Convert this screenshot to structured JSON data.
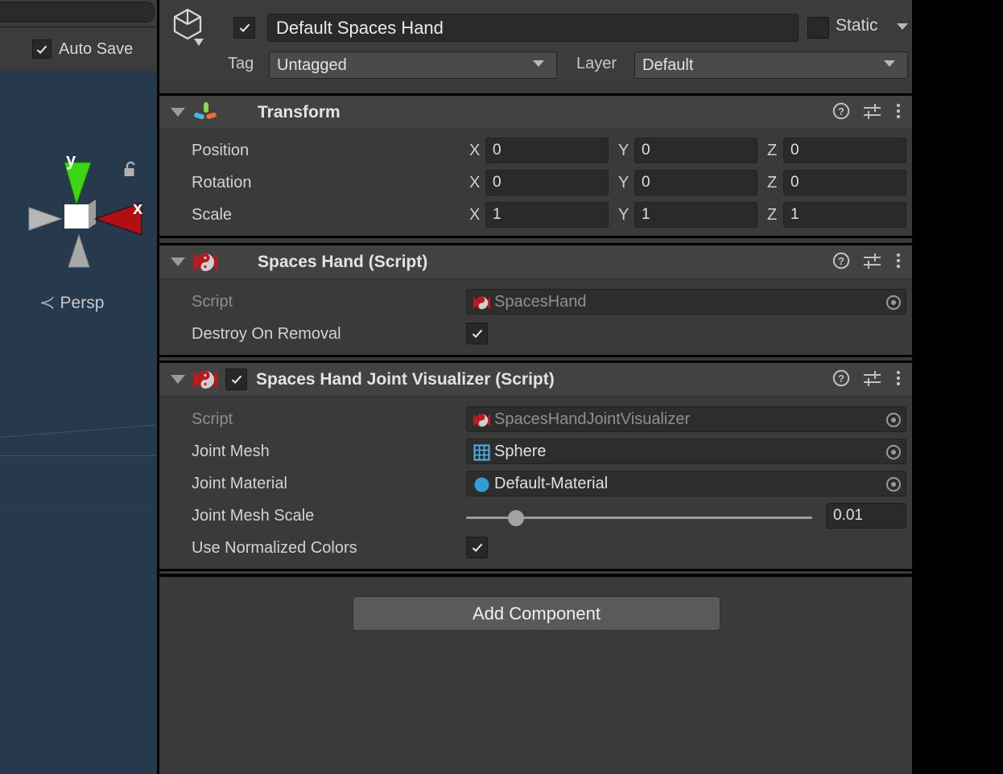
{
  "left_panel": {
    "search_placeholder": "",
    "search_value": "",
    "auto_save_label": "Auto Save",
    "auto_save_checked": true,
    "scene_gizmo": {
      "axis_y_label": "y",
      "axis_x_label": "x",
      "projection_label": "Persp",
      "lock_icon": "unlocked-padlock-icon",
      "colors": {
        "background": "#27394d",
        "y_axis": "#3dd614",
        "x_axis": "#b01014",
        "neutral_axis": "#b9b9b9"
      }
    }
  },
  "inspector": {
    "object_header": {
      "prefab_icon": "cube-outline-icon",
      "active_checked": true,
      "name_value": "Default Spaces Hand",
      "static_label": "Static",
      "static_checked": false,
      "tag_label": "Tag",
      "tag_value": "Untagged",
      "layer_label": "Layer",
      "layer_value": "Default"
    },
    "components": [
      {
        "title": "Transform",
        "icon": "transform-axis-icon",
        "expanded": true,
        "has_enable_checkbox": false,
        "rows": [
          {
            "label": "Position",
            "type": "vector3",
            "x": "0",
            "y": "0",
            "z": "0"
          },
          {
            "label": "Rotation",
            "type": "vector3",
            "x": "0",
            "y": "0",
            "z": "0"
          },
          {
            "label": "Scale",
            "type": "vector3",
            "x": "1",
            "y": "1",
            "z": "1"
          }
        ]
      },
      {
        "title": "Spaces Hand (Script)",
        "icon": "script-logo-icon",
        "expanded": true,
        "has_enable_checkbox": false,
        "rows": [
          {
            "label": "Script",
            "type": "object",
            "value": "SpacesHand",
            "icon": "script-logo-icon",
            "dim": true
          },
          {
            "label": "Destroy On Removal",
            "type": "bool",
            "checked": true
          }
        ]
      },
      {
        "title": "Spaces Hand Joint Visualizer (Script)",
        "icon": "script-logo-icon",
        "expanded": true,
        "has_enable_checkbox": true,
        "enabled": true,
        "rows": [
          {
            "label": "Script",
            "type": "object",
            "value": "SpacesHandJointVisualizer",
            "icon": "script-logo-icon",
            "dim": true
          },
          {
            "label": "Joint Mesh",
            "type": "object",
            "value": "Sphere",
            "icon": "mesh-grid-icon",
            "dim": false
          },
          {
            "label": "Joint Material",
            "type": "object",
            "value": "Default-Material",
            "icon": "material-sphere-icon",
            "dim": false
          },
          {
            "label": "Joint Mesh Scale",
            "type": "slider",
            "value": "0.01",
            "fraction": 0.12
          },
          {
            "label": "Use Normalized Colors",
            "type": "bool",
            "checked": true
          }
        ]
      }
    ],
    "header_icons": {
      "help": "help-circle-icon",
      "preset": "preset-sliders-icon",
      "menu": "kebab-menu-icon"
    },
    "add_component_label": "Add Component"
  }
}
